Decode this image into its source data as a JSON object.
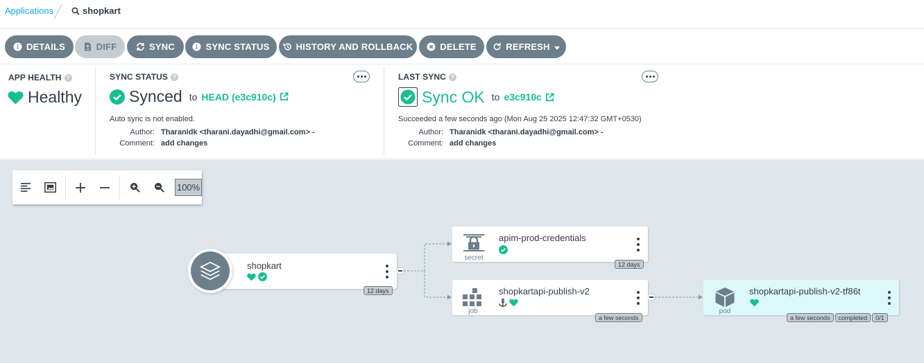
{
  "breadcrumb": {
    "applications_label": "Applications",
    "current_app": "shopkart"
  },
  "toolbar": {
    "details": "DETAILS",
    "diff": "DIFF",
    "sync": "SYNC",
    "sync_status": "SYNC STATUS",
    "history": "HISTORY AND ROLLBACK",
    "delete": "DELETE",
    "refresh": "REFRESH"
  },
  "app_health": {
    "title": "APP HEALTH",
    "value": "Healthy"
  },
  "sync_status": {
    "title": "SYNC STATUS",
    "value": "Synced",
    "to_label": "to",
    "revision": "HEAD (e3c910c)",
    "note": "Auto sync is not enabled.",
    "author_label": "Author:",
    "author": "Tharanidk <tharani.dayadhi@gmail.com> -",
    "comment_label": "Comment:",
    "comment": "add changes"
  },
  "last_sync": {
    "title": "LAST SYNC",
    "value": "Sync OK",
    "to_label": "to",
    "revision": "e3c910c",
    "note": "Succeeded a few seconds ago (Mon Aug 25 2025 12:47:32 GMT+0530)",
    "author_label": "Author:",
    "author": "Tharanidk <tharani.dayadhi@gmail.com> -",
    "comment_label": "Comment:",
    "comment": "add changes"
  },
  "graph_tools": {
    "zoom": "100%"
  },
  "nodes": {
    "app": {
      "name": "shopkart",
      "age": "12 days"
    },
    "secret": {
      "name": "apim-prod-credentials",
      "kind": "secret",
      "age": "12 days"
    },
    "job": {
      "name": "shopkartapi-publish-v2",
      "kind": "job",
      "age": "a few seconds"
    },
    "pod": {
      "name": "shopkartapi-publish-v2-tf86t",
      "kind": "pod",
      "age": "a few seconds",
      "status": "completed",
      "ready": "0/1"
    }
  },
  "colors": {
    "accent": "#18be94",
    "button": "#6d7f8b",
    "link": "#0dadea",
    "canvas": "#dee6eb"
  }
}
